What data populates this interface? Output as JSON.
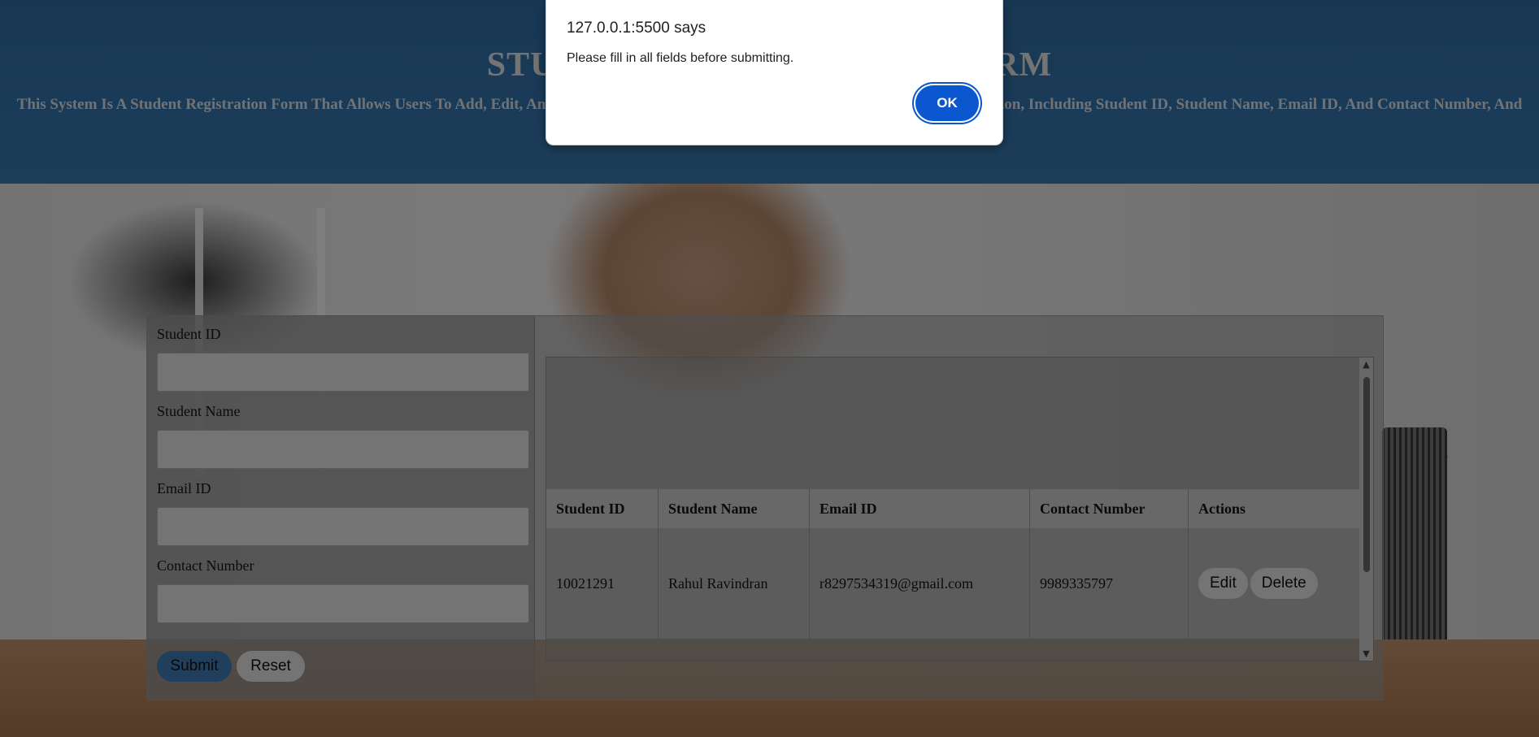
{
  "header": {
    "title": "STUDENT REGISTRATION FORM",
    "description": "This System Is A Student Registration Form That Allows Users To Add, Edit, And Delete Student Records. The System Stores Basic Student Information, Including Student ID, Student Name, Email ID, And Contact Number, And Uses Local Storage For Data Storing."
  },
  "form": {
    "fields": [
      {
        "label": "Student ID",
        "value": "",
        "placeholder": ""
      },
      {
        "label": "Student Name",
        "value": "",
        "placeholder": ""
      },
      {
        "label": "Email ID",
        "value": "",
        "placeholder": ""
      },
      {
        "label": "Contact Number",
        "value": "",
        "placeholder": ""
      }
    ],
    "submit_label": "Submit",
    "reset_label": "Reset"
  },
  "table": {
    "columns": [
      "Student ID",
      "Student Name",
      "Email ID",
      "Contact Number",
      "Actions"
    ],
    "rows": [
      {
        "student_id": "10021291",
        "student_name": "Rahul Ravindran",
        "email": "r8297534319@gmail.com",
        "contact": "9989335797",
        "edit_label": "Edit",
        "delete_label": "Delete"
      }
    ]
  },
  "dialog": {
    "origin": "127.0.0.1:5500 says",
    "message": "Please fill in all fields before submitting.",
    "ok_label": "OK"
  },
  "colors": {
    "header_bg": "#2f6fa8",
    "submit_button": "#3f7fb8",
    "dialog_ok_button": "#0b57d0"
  },
  "icons": {
    "scroll_up": "scroll-up-arrow-icon",
    "scroll_down": "scroll-down-arrow-icon"
  }
}
